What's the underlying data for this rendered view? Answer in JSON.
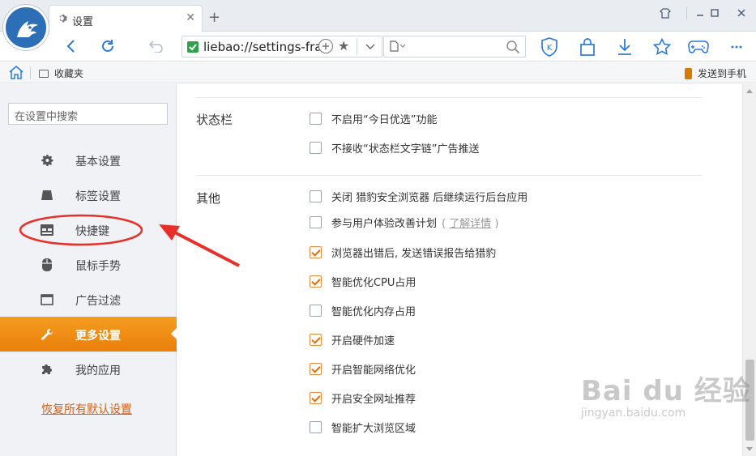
{
  "titlebar": {
    "tab_title": "设置",
    "tab_close": "✕",
    "new_tab": "+",
    "controls": [
      "minimize",
      "restore",
      "close"
    ]
  },
  "navbar": {
    "url": "liebao://settings-fra",
    "search_engine_icon": "page-icon"
  },
  "bookmarks": {
    "favorites_label": "收藏夹",
    "send_to_phone_label": "发送到手机"
  },
  "sidebar": {
    "search_placeholder": "在设置中搜索",
    "items": [
      {
        "label": "基本设置",
        "icon": "gear-icon"
      },
      {
        "label": "标签设置",
        "icon": "tab-icon"
      },
      {
        "label": "快捷键",
        "icon": "keyboard-icon"
      },
      {
        "label": "鼠标手势",
        "icon": "mouse-icon"
      },
      {
        "label": "广告过滤",
        "icon": "window-icon"
      },
      {
        "label": "更多设置",
        "icon": "wrench-icon",
        "active": true
      },
      {
        "label": "我的应用",
        "icon": "puzzle-icon"
      }
    ],
    "reset_label": "恢复所有默认设置"
  },
  "main": {
    "sections": [
      {
        "title": "状态栏",
        "options": [
          {
            "label": "不启用“今日优选”功能",
            "checked": false
          },
          {
            "label": "不接收“状态栏文字链”广告推送",
            "checked": false
          }
        ]
      },
      {
        "title": "其他",
        "options": [
          {
            "label": "关闭 猎豹安全浏览器 后继续运行后台应用",
            "checked": false
          },
          {
            "label": "参与用户体验改善计划",
            "checked": false,
            "link_open": "(",
            "link": "了解详情",
            "link_close": ")"
          },
          {
            "label": "浏览器出错后, 发送错误报告给猎豹",
            "checked": true
          },
          {
            "label": "智能优化CPU占用",
            "checked": true
          },
          {
            "label": "智能优化内存占用",
            "checked": false
          },
          {
            "label": "开启硬件加速",
            "checked": true
          },
          {
            "label": "开启智能网络优化",
            "checked": true
          },
          {
            "label": "开启安全网址推荐",
            "checked": true
          },
          {
            "label": "智能扩大浏览区域",
            "checked": false
          }
        ]
      }
    ]
  },
  "watermark": {
    "line1": "Bai du 经验",
    "line2": "jingyan.baidu.com"
  },
  "colors": {
    "accent": "#ef8a14",
    "checkbox_check": "#e06d10",
    "annotation_red": "#e8302a",
    "logo_blue": "#2d6fb7"
  }
}
